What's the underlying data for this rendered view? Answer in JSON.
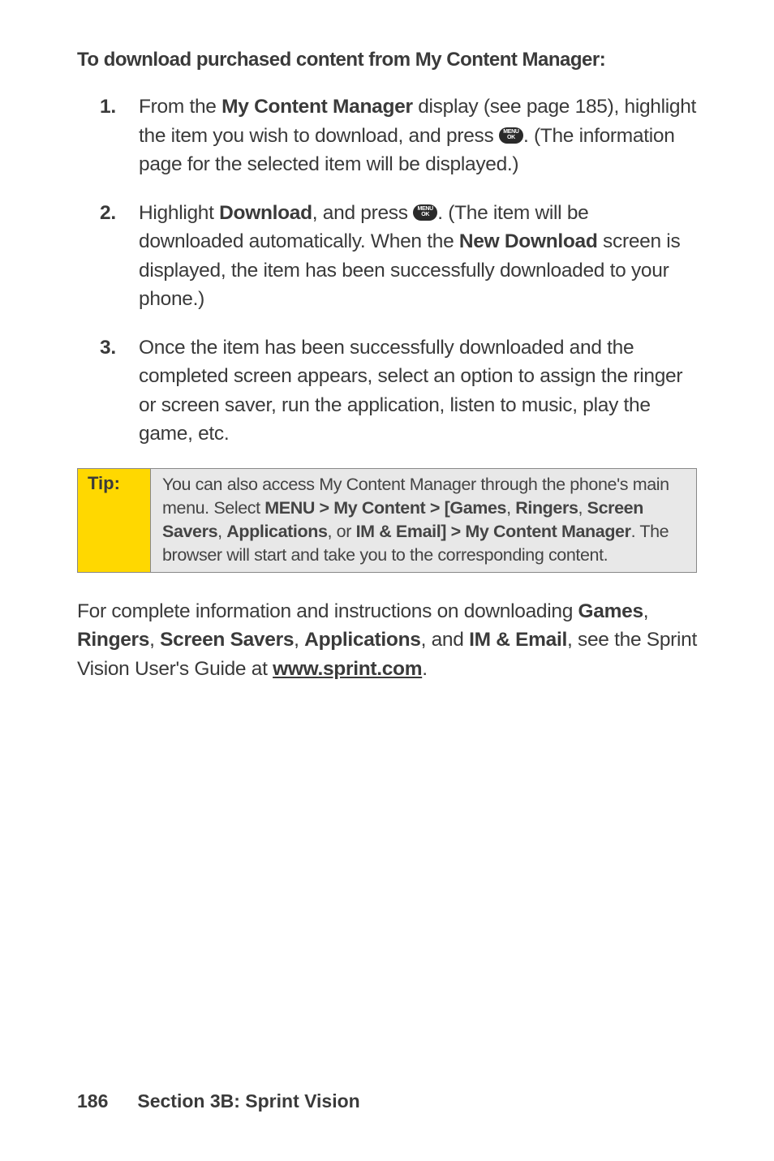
{
  "heading": "To download purchased content from My Content Manager:",
  "steps": [
    {
      "marker": "1.",
      "prefix": "From the ",
      "bold1": "My Content Manager",
      "mid1": " display (see page 185), highlight the item you wish to download, and press ",
      "afterIcon": ". (The information page for the selected item will be displayed.)"
    },
    {
      "marker": "2.",
      "prefix": "Highlight ",
      "bold1": "Download",
      "mid1": ", and press ",
      "afterIcon": ". (The item will be downloaded automatically. When the ",
      "bold2": "New Download",
      "tail": " screen is displayed, the item has been successfully downloaded to your phone.)"
    },
    {
      "marker": "3.",
      "prefix": "Once the item has been successfully downloaded and the completed screen appears, select an option to assign the ringer or screen saver, run the application, listen to music, play the game, etc."
    }
  ],
  "iconLabel": "MENU\nOK",
  "tip": {
    "label": "Tip:",
    "line1": "You can also access My Content Manager through the phone's main menu. Select ",
    "bold1": "MENU > My Content > [Games",
    "sep1": ", ",
    "bold2": "Ringers",
    "sep2": ", ",
    "bold3": "Screen Savers",
    "sep3": ", ",
    "bold4": "Applications",
    "sep4": ", or ",
    "bold5": "IM & Email] > My Content Manager",
    "tail": ". The browser will start and take you to the corresponding content."
  },
  "para": {
    "p1": "For complete information and instructions on downloading ",
    "b1": "Games",
    "s1": ", ",
    "b2": "Ringers",
    "s2": ", ",
    "b3": "Screen Savers",
    "s3": ", ",
    "b4": "Applications",
    "s4": ", and ",
    "b5": "IM & Email",
    "p2": ", see the Sprint Vision User's Guide at  ",
    "link": "www.sprint.com",
    "p3": "."
  },
  "footer": {
    "page": "186",
    "section": "Section 3B: Sprint Vision"
  }
}
